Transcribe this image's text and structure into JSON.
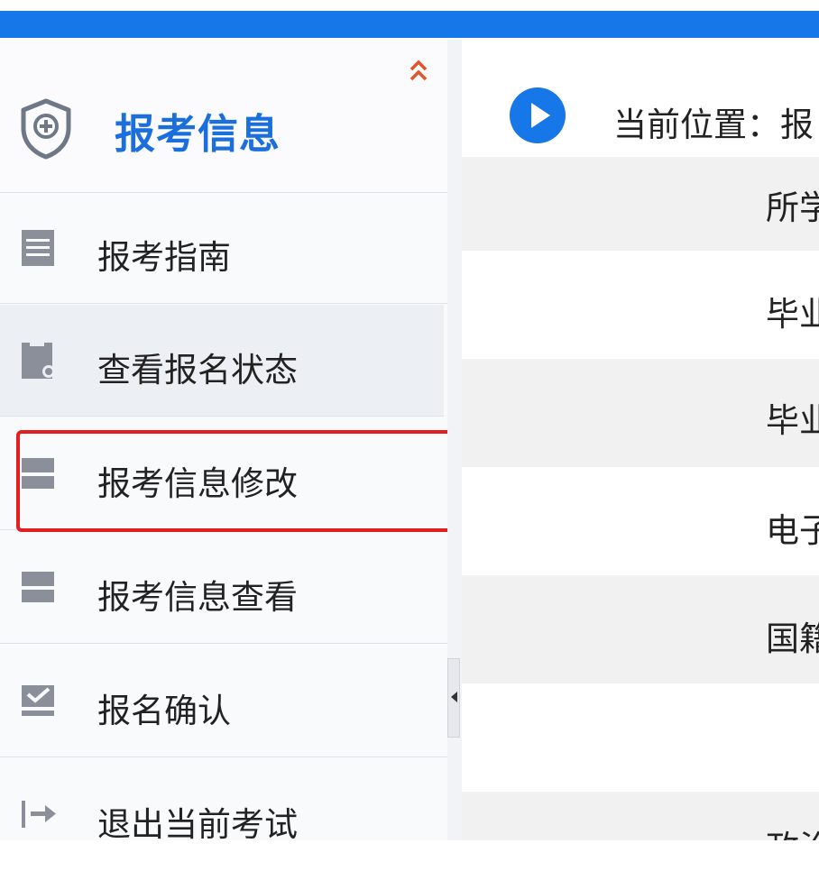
{
  "colors": {
    "top_bar": "#1677e8",
    "title": "#1b6fdc",
    "highlight_border": "#e21e1e",
    "collapse_arrow": "#e0552a"
  },
  "sidebar": {
    "title": "报考信息",
    "header_icon": "shield-plus-icon",
    "collapse_icon": "double-chevron-up-icon",
    "items": [
      {
        "label": "报考指南",
        "icon": "document-lines-icon"
      },
      {
        "label": "查看报名状态",
        "icon": "document-search-icon",
        "active": true
      },
      {
        "label": "报考信息修改",
        "icon": "edit-bars-icon",
        "highlighted": true
      },
      {
        "label": "报考信息查看",
        "icon": "view-bars-icon"
      },
      {
        "label": "报名确认",
        "icon": "checkbox-icon"
      },
      {
        "label": "退出当前考试",
        "icon": "exit-arrow-icon"
      }
    ]
  },
  "main": {
    "breadcrumb": "当前位置：报",
    "rows": [
      "所学",
      "毕业",
      "毕业",
      "电子",
      "国籍",
      "",
      "政治"
    ]
  }
}
